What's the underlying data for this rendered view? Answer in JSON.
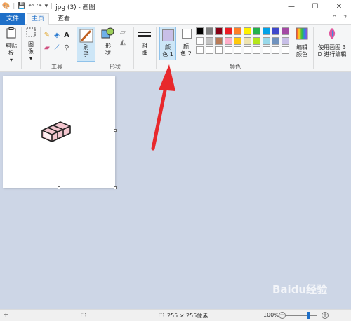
{
  "window": {
    "title": "jpg (3) - 画图",
    "minimize": "—",
    "maximize": "☐",
    "close": "✕"
  },
  "tabs": {
    "file": "文件",
    "home": "主页",
    "view": "查看"
  },
  "ribbon": {
    "clipboard": "剪贴板",
    "image": "图像",
    "tools_group": "工具",
    "brush_line1": "刷",
    "brush_line2": "子",
    "shapes_line1": "形",
    "shapes_line2": "状",
    "shapes_group": "形状",
    "size_line1": "粗",
    "size_line2": "细",
    "color1_line1": "颜",
    "color1_line2": "色 1",
    "color2_line1": "颜",
    "color2_line2": "色 2",
    "edit_colors_line1": "编辑",
    "edit_colors_line2": "颜色",
    "colors_group": "颜色",
    "paint3d_line1": "使用画图 3",
    "paint3d_line2": "D 进行编辑",
    "text_tool": "A"
  },
  "palette": {
    "row1": [
      "#000000",
      "#7f7f7f",
      "#880015",
      "#ed1c24",
      "#ff7f27",
      "#fff200",
      "#22b14c",
      "#00a2e8",
      "#3f48cc",
      "#a349a4"
    ],
    "row2": [
      "#ffffff",
      "#c3c3c3",
      "#b97a57",
      "#ffaec9",
      "#ffc90e",
      "#efe4b0",
      "#b5e61d",
      "#99d9ea",
      "#7092be",
      "#c8bfe7"
    ],
    "row3": [
      "#ffffff",
      "#ffffff",
      "#ffffff",
      "#ffffff",
      "#ffffff",
      "#ffffff",
      "#ffffff",
      "#ffffff",
      "#ffffff",
      "#ffffff"
    ]
  },
  "colors": {
    "color1": "#c8bfe7",
    "color2": "#ffffff",
    "accent": "#1e6fc8",
    "arrow": "#e8282c"
  },
  "status": {
    "image_size": "255 × 255像素",
    "zoom": "100%",
    "zoom_out": "−",
    "zoom_in": "+"
  },
  "watermark": "Baidu经验"
}
